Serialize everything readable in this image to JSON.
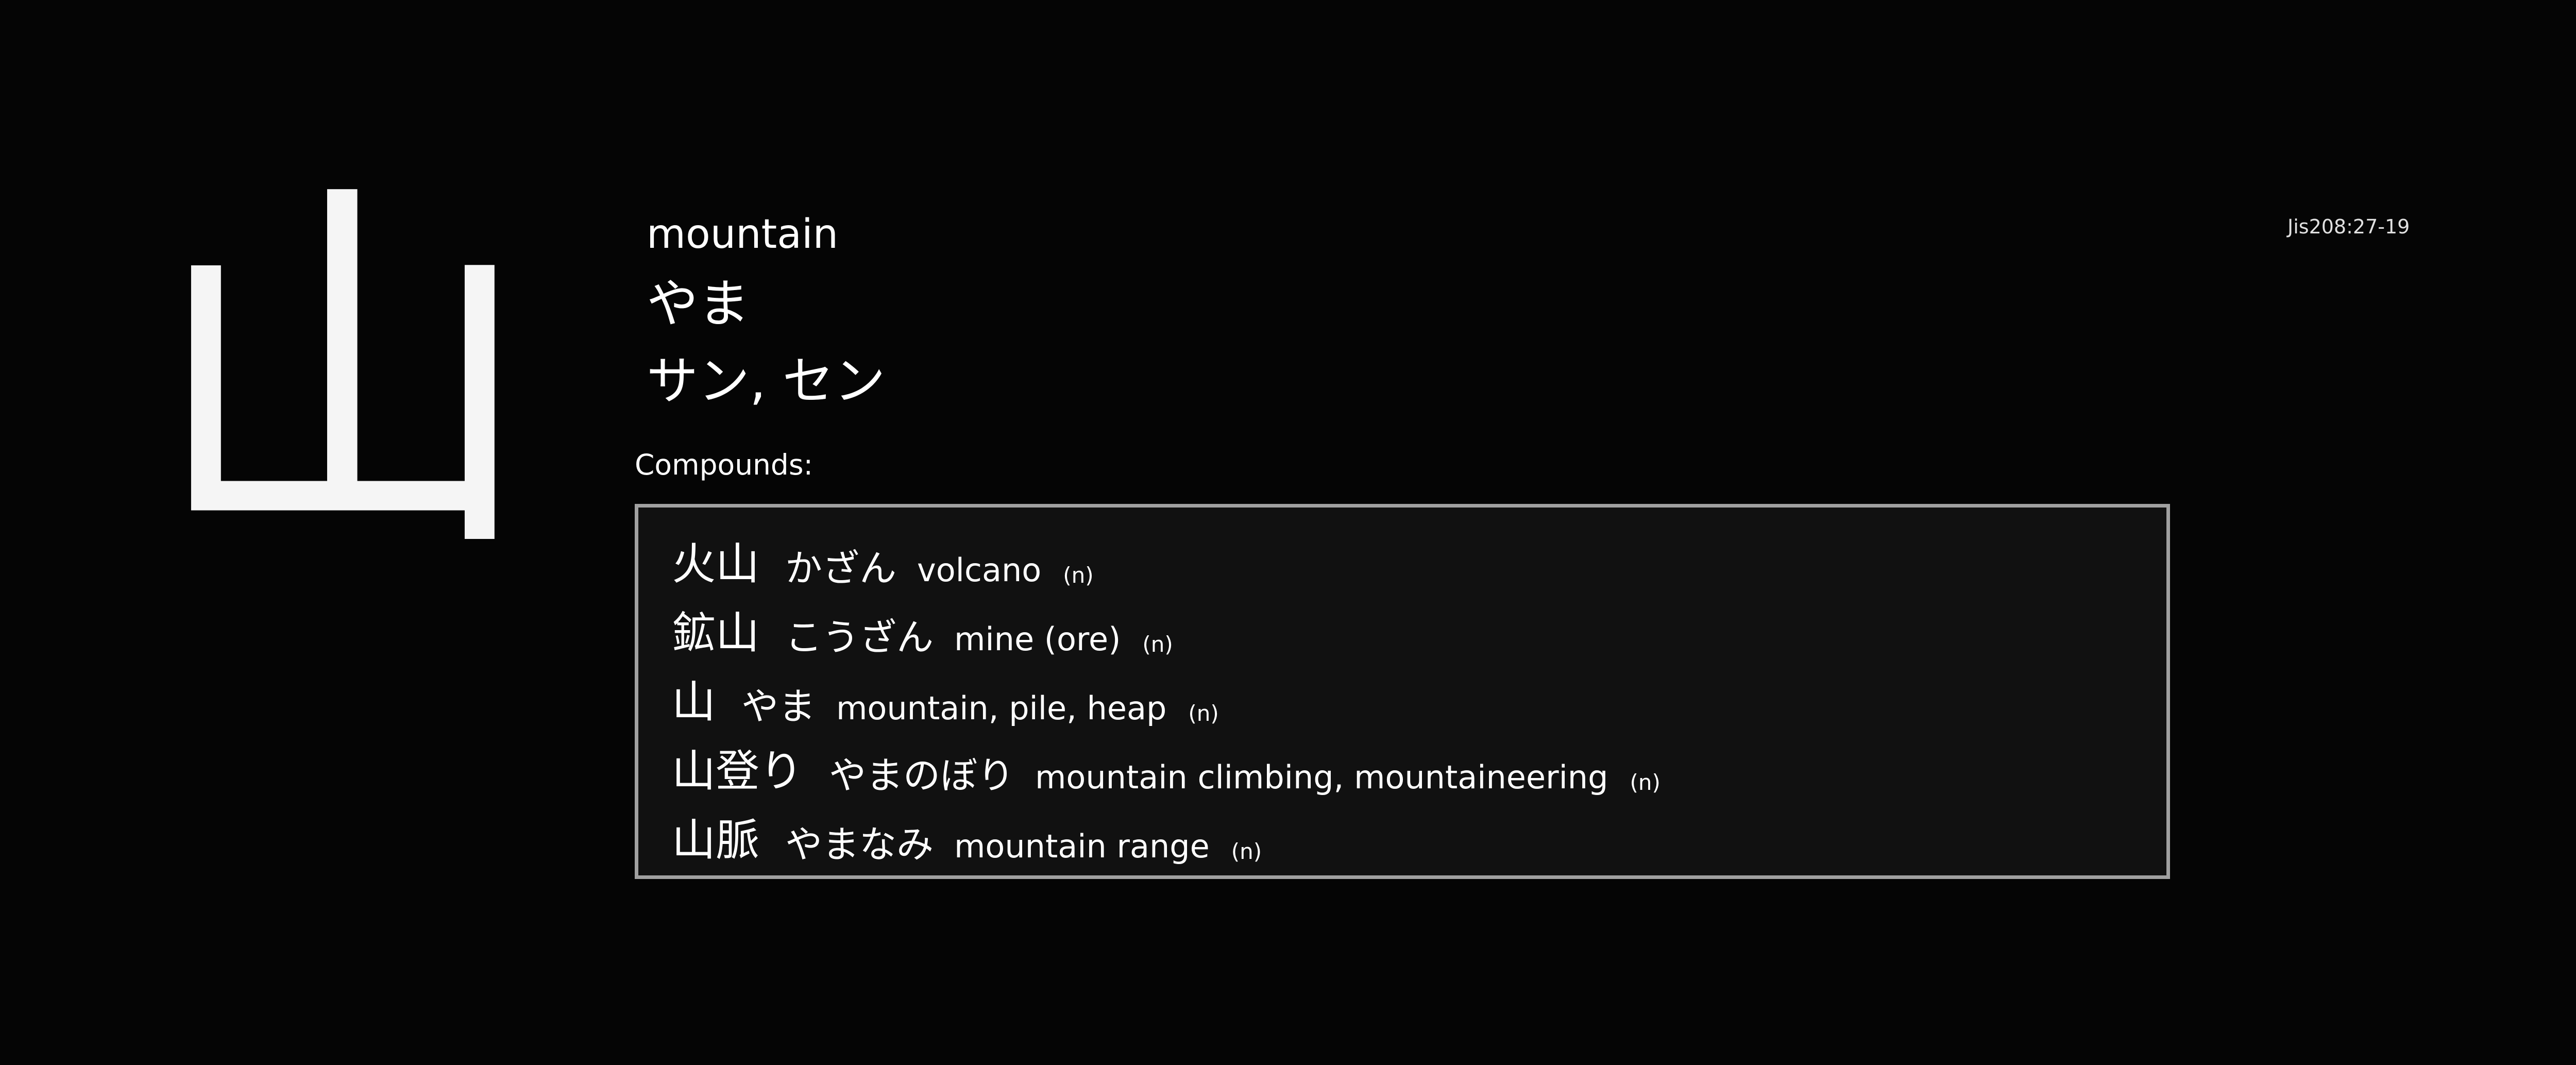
{
  "kanji": "山",
  "meaning": "mountain",
  "kun_reading": "やま",
  "on_reading": "サン, セン",
  "jis_code": "Jis208:27-19",
  "compounds_label": "Compounds:",
  "compounds": [
    {
      "word": "火山",
      "kana": "かざん",
      "definition": "volcano",
      "pos": "(n)"
    },
    {
      "word": "鉱山",
      "kana": "こうざん",
      "definition": "mine (ore)",
      "pos": "(n)"
    },
    {
      "word": "山",
      "kana": "やま",
      "definition": "mountain, pile, heap",
      "pos": "(n)"
    },
    {
      "word": "山登り",
      "kana": "やまのぼり",
      "definition": "mountain climbing, mountaineering",
      "pos": "(n)"
    },
    {
      "word": "山脈",
      "kana": "やまなみ",
      "definition": "mountain range",
      "pos": "(n)"
    }
  ]
}
